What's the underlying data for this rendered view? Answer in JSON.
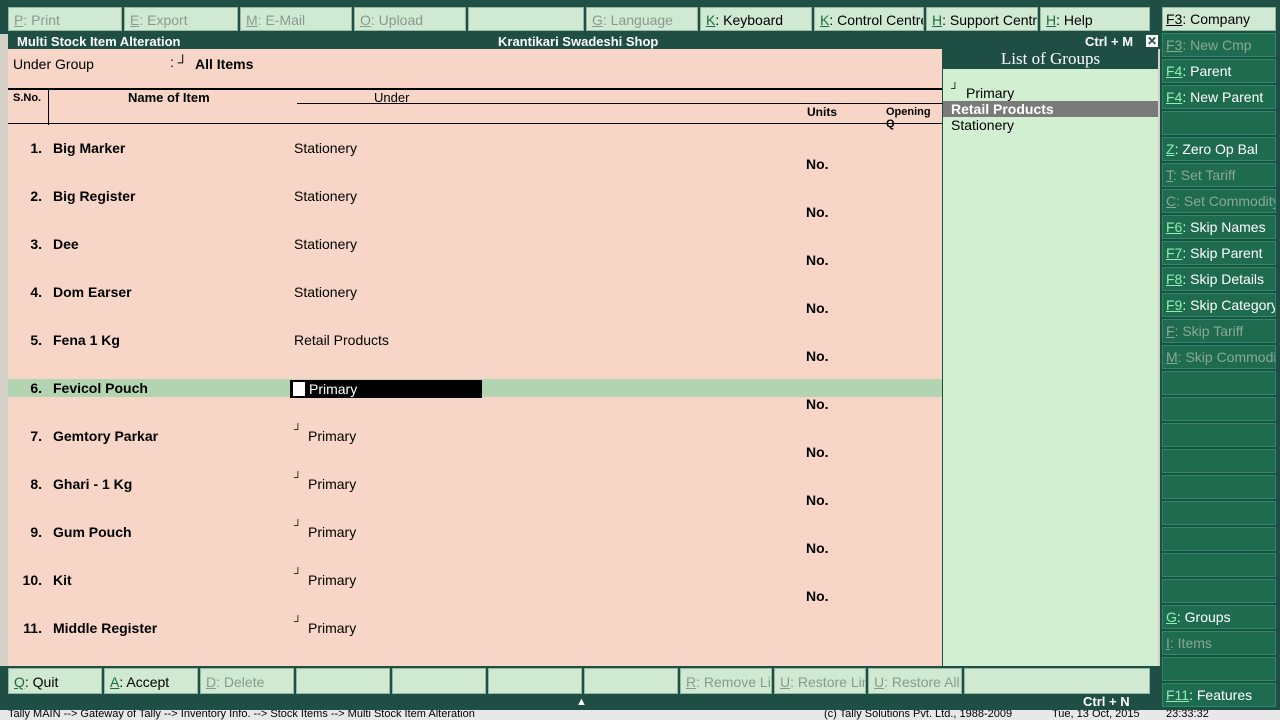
{
  "topbar": [
    {
      "key": "P",
      "label": ": Print",
      "enabled": false
    },
    {
      "key": "E",
      "label": ": Export",
      "enabled": false
    },
    {
      "key": "M",
      "label": ": E-Mail",
      "enabled": false
    },
    {
      "key": "O",
      "label": ": Upload",
      "enabled": false
    },
    {
      "key": "",
      "label": "",
      "enabled": false
    },
    {
      "key": "G",
      "label": ": Language",
      "enabled": false
    },
    {
      "key": "K",
      "label": ": Keyboard",
      "enabled": true
    },
    {
      "key": "K",
      "label": ": Control Centre",
      "enabled": true
    },
    {
      "key": "H",
      "label": ": Support Centre",
      "enabled": true
    },
    {
      "key": "H",
      "label": ": Help",
      "enabled": true
    }
  ],
  "title": {
    "screen": "Multi Stock Item  Alteration",
    "company": "Krantikari Swadeshi Shop",
    "shortcut": "Ctrl + M",
    "close": "✕"
  },
  "form": {
    "under_group_label": "Under Group",
    "under_group_colon": ": ┘",
    "under_group_value": "All Items"
  },
  "columns": {
    "sno": "S.No.",
    "name": "Name of Item",
    "under": "Under",
    "units": "Units",
    "opening": "Opening Q"
  },
  "rows": [
    {
      "sno": "1.",
      "name": "Big Marker",
      "under": "Stationery",
      "tick": "",
      "units": "No."
    },
    {
      "sno": "2.",
      "name": "Big Register",
      "under": "Stationery",
      "tick": "",
      "units": "No."
    },
    {
      "sno": "3.",
      "name": "Dee",
      "under": "Stationery",
      "tick": "",
      "units": "No."
    },
    {
      "sno": "4.",
      "name": "Dom Earser",
      "under": "Stationery",
      "tick": "",
      "units": "No."
    },
    {
      "sno": "5.",
      "name": "Fena 1 Kg",
      "under": "Retail Products",
      "tick": "",
      "units": "No."
    },
    {
      "sno": "6.",
      "name": "Fevicol Pouch",
      "under": "Primary",
      "tick": "",
      "units": "No."
    },
    {
      "sno": "7.",
      "name": "Gemtory Parkar",
      "under": "Primary",
      "tick": "┘",
      "units": "No."
    },
    {
      "sno": "8.",
      "name": "Ghari - 1 Kg",
      "under": "Primary",
      "tick": "┘",
      "units": "No."
    },
    {
      "sno": "9.",
      "name": "Gum Pouch",
      "under": "Primary",
      "tick": "┘",
      "units": "No."
    },
    {
      "sno": "10.",
      "name": "Kit",
      "under": "Primary",
      "tick": "┘",
      "units": "No."
    },
    {
      "sno": "11.",
      "name": "Middle Register",
      "under": "Primary",
      "tick": "┘",
      "units": ""
    }
  ],
  "list_of_groups": {
    "title": "List of Groups",
    "tick": "┘",
    "items": [
      "Primary",
      "Retail Products",
      "Stationery"
    ],
    "highlighted": "Retail Products"
  },
  "sidebar": [
    {
      "key": "F3",
      "label": ": Company",
      "enabled": true
    },
    {
      "key": "F3",
      "label": ": New Cmp",
      "enabled": false
    },
    {
      "key": "F4",
      "label": ": Parent",
      "enabled": true
    },
    {
      "key": "F4",
      "label": ": New Parent",
      "enabled": true
    },
    {
      "key": "",
      "label": "",
      "enabled": true
    },
    {
      "key": "Z",
      "label": ": Zero Op Bal",
      "enabled": true
    },
    {
      "key": "T",
      "label": ": Set Tariff",
      "enabled": false
    },
    {
      "key": "C",
      "label": ": Set Commodity",
      "enabled": false
    },
    {
      "key": "F6",
      "label": ": Skip Names",
      "enabled": true
    },
    {
      "key": "F7",
      "label": ": Skip Parent",
      "enabled": true
    },
    {
      "key": "F8",
      "label": ": Skip Details",
      "enabled": true
    },
    {
      "key": "F9",
      "label": ": Skip Category",
      "enabled": true
    },
    {
      "key": "F",
      "label": ": Skip Tariff",
      "enabled": false
    },
    {
      "key": "M",
      "label": ": Skip Commodity",
      "enabled": false
    },
    {
      "key": "",
      "label": "",
      "enabled": true
    },
    {
      "key": "",
      "label": "",
      "enabled": true
    },
    {
      "key": "",
      "label": "",
      "enabled": true
    },
    {
      "key": "",
      "label": "",
      "enabled": true
    },
    {
      "key": "",
      "label": "",
      "enabled": true
    },
    {
      "key": "",
      "label": "",
      "enabled": true
    },
    {
      "key": "",
      "label": "",
      "enabled": true
    },
    {
      "key": "",
      "label": "",
      "enabled": true
    },
    {
      "key": "",
      "label": "",
      "enabled": true
    },
    {
      "key": "G",
      "label": ": Groups",
      "enabled": true
    },
    {
      "key": "I",
      "label": ": Items",
      "enabled": false
    },
    {
      "key": "",
      "label": "",
      "enabled": true
    },
    {
      "key": "F11",
      "label": ": Features",
      "enabled": true
    }
  ],
  "bottombar": [
    {
      "key": "Q",
      "label": ": Quit",
      "enabled": true
    },
    {
      "key": "A",
      "label": ": Accept",
      "enabled": true
    },
    {
      "key": "D",
      "label": ": Delete",
      "enabled": false
    },
    {
      "key": "",
      "label": "",
      "enabled": false
    },
    {
      "key": "",
      "label": "",
      "enabled": false
    },
    {
      "key": "",
      "label": "",
      "enabled": false
    },
    {
      "key": "",
      "label": "",
      "enabled": false
    },
    {
      "key": "R",
      "label": ": Remove Line",
      "enabled": false
    },
    {
      "key": "U",
      "label": ": Restore Line",
      "enabled": false
    },
    {
      "key": "U",
      "label": ": Restore All",
      "enabled": false
    },
    {
      "key": "",
      "label": "",
      "enabled": false
    }
  ],
  "footer": {
    "shortcut": "Ctrl + N",
    "arrow": "▲"
  },
  "statusbar": {
    "path": "Tally MAIN  --> Gateway of Tally  --> Inventory Info.  --> Stock Items  --> Multi Stock Item  Alteration",
    "copyright": "(c) Tally Solutions Pvt. Ltd., 1988-2009",
    "date": "Tue, 13 Oct, 2015",
    "time": "23:33:32"
  },
  "colors": {
    "frame": "#1f4e45",
    "main_bg": "#f7d6c8",
    "panel_bg": "#d2efd2",
    "button_bg": "#cfe9d2",
    "selected_row": "#b3d4b0"
  }
}
